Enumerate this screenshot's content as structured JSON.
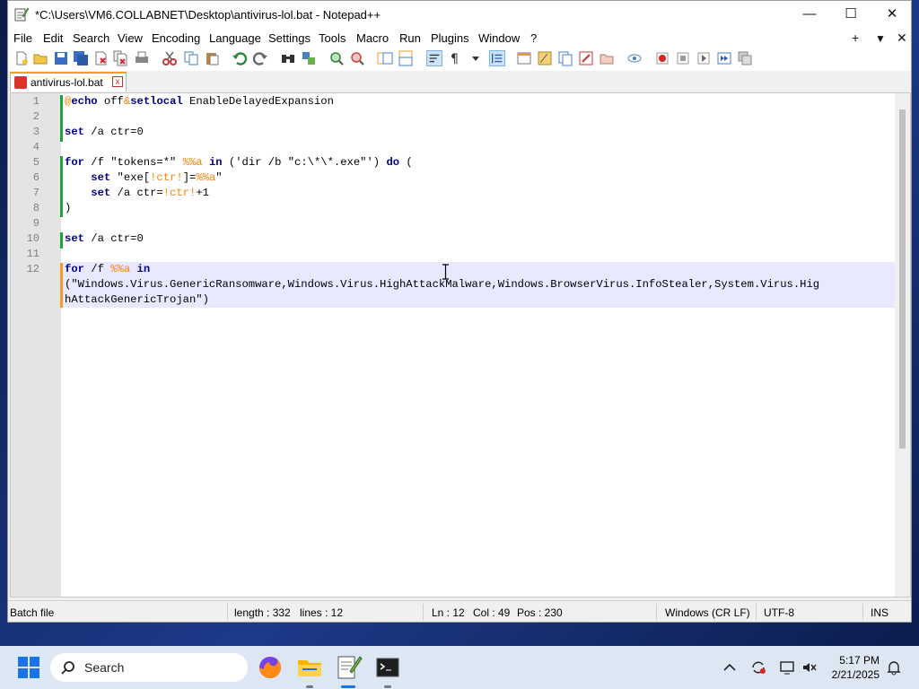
{
  "window": {
    "title": "*C:\\Users\\VM6.COLLABNET\\Desktop\\antivirus-lol.bat - Notepad++",
    "minimize": "—",
    "maximize": "☐",
    "close": "✕"
  },
  "menu": {
    "items": [
      "File",
      "Edit",
      "Search",
      "View",
      "Encoding",
      "Language",
      "Settings",
      "Tools",
      "Macro",
      "Run",
      "Plugins",
      "Window",
      "?"
    ],
    "right": [
      "+",
      "▼",
      "✕"
    ]
  },
  "toolbar": {
    "icons": [
      "new-file",
      "open-file",
      "save",
      "save-all",
      "close",
      "close-all",
      "print",
      "cut",
      "copy",
      "paste",
      "undo",
      "redo",
      "find",
      "replace",
      "zoom-in",
      "zoom-out",
      "sync-v",
      "sync-h",
      "word-wrap",
      "show-all-chars",
      "indent-guide",
      "udl",
      "doc-map",
      "func-list",
      "folder-workspace",
      "monitor",
      "record-macro",
      "stop-macro",
      "play-macro",
      "run-macro-multiple",
      "save-macro"
    ]
  },
  "tab": {
    "label": "antivirus-lol.bat",
    "close": "x"
  },
  "editor": {
    "line_numbers": [
      "1",
      "2",
      "3",
      "4",
      "5",
      "6",
      "7",
      "8",
      "9",
      "10",
      "11",
      "12"
    ],
    "lines": [
      [
        {
          "t": "@",
          "c": "var"
        },
        {
          "t": "echo",
          "c": "kw"
        },
        {
          "t": " off",
          "c": ""
        },
        {
          "t": "&",
          "c": "var"
        },
        {
          "t": "setlocal",
          "c": "kw"
        },
        {
          "t": " EnableDelayedExpansion",
          "c": ""
        }
      ],
      [],
      [
        {
          "t": "set",
          "c": "kw"
        },
        {
          "t": " /a ctr=0",
          "c": ""
        }
      ],
      [],
      [
        {
          "t": "for",
          "c": "kw"
        },
        {
          "t": " /f \"tokens=*\" ",
          "c": ""
        },
        {
          "t": "%%a",
          "c": "var"
        },
        {
          "t": " ",
          "c": ""
        },
        {
          "t": "in",
          "c": "kw"
        },
        {
          "t": " ('dir /b \"c:\\*\\*.exe\"') ",
          "c": ""
        },
        {
          "t": "do",
          "c": "kw"
        },
        {
          "t": " (",
          "c": ""
        }
      ],
      [
        {
          "t": "    ",
          "c": ""
        },
        {
          "t": "set",
          "c": "kw"
        },
        {
          "t": " \"exe[",
          "c": ""
        },
        {
          "t": "!ctr!",
          "c": "var"
        },
        {
          "t": "]=",
          "c": ""
        },
        {
          "t": "%%a",
          "c": "var"
        },
        {
          "t": "\"",
          "c": ""
        }
      ],
      [
        {
          "t": "    ",
          "c": ""
        },
        {
          "t": "set",
          "c": "kw"
        },
        {
          "t": " /a ctr=",
          "c": ""
        },
        {
          "t": "!ctr!",
          "c": "var"
        },
        {
          "t": "+1",
          "c": ""
        }
      ],
      [
        {
          "t": ")",
          "c": ""
        }
      ],
      [],
      [
        {
          "t": "set",
          "c": "kw"
        },
        {
          "t": " /a ctr=0",
          "c": ""
        }
      ],
      [],
      [
        {
          "t": "for",
          "c": "kw"
        },
        {
          "t": " /f ",
          "c": ""
        },
        {
          "t": "%%a",
          "c": "var"
        },
        {
          "t": " ",
          "c": ""
        },
        {
          "t": "in",
          "c": "kw"
        }
      ],
      [
        {
          "t": "(\"Windows.Virus.GenericRansomware,Windows.Virus.HighAttackMalware,Windows.BrowserVirus.InfoStealer,System.Virus.Hig",
          "c": ""
        }
      ],
      [
        {
          "t": "hAttackGenericTrojan\")",
          "c": ""
        }
      ]
    ]
  },
  "status": {
    "filetype": "Batch file",
    "length": "length : 332",
    "lines": "lines : 12",
    "ln": "Ln : 12",
    "col": "Col : 49",
    "pos": "Pos : 230",
    "eol": "Windows (CR LF)",
    "encoding": "UTF-8",
    "mode": "INS"
  },
  "taskbar": {
    "search_placeholder": "Search",
    "time": "5:17 PM",
    "date": "2/21/2025"
  }
}
